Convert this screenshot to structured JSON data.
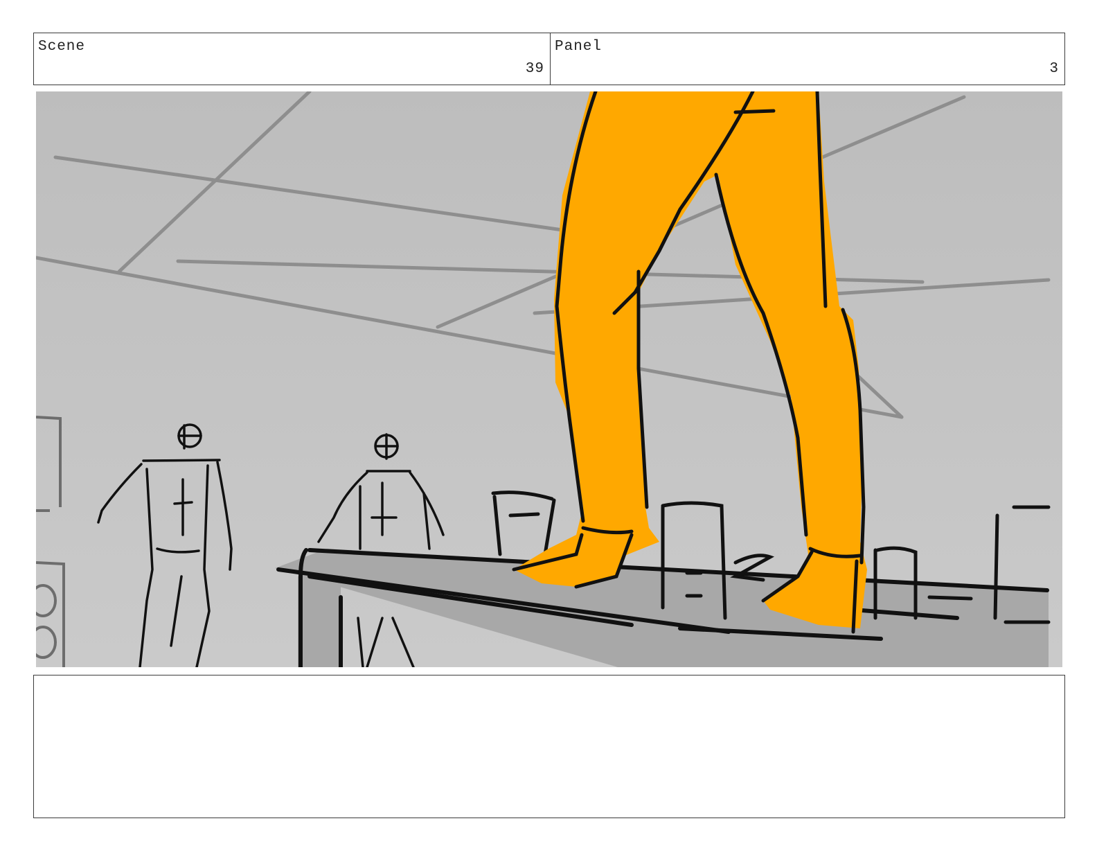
{
  "header": {
    "scene_label": "Scene",
    "scene_number": "39",
    "panel_label": "Panel",
    "panel_number": "3"
  },
  "artwork": {
    "description_name": "storyboard-sketch",
    "colors": {
      "background": "#c4c4c4",
      "ceiling_lines": "#8f8f8f",
      "table": "#a9a9a9",
      "outline": "#111111",
      "character": "#ffa800"
    }
  },
  "notes": {
    "text": ""
  }
}
